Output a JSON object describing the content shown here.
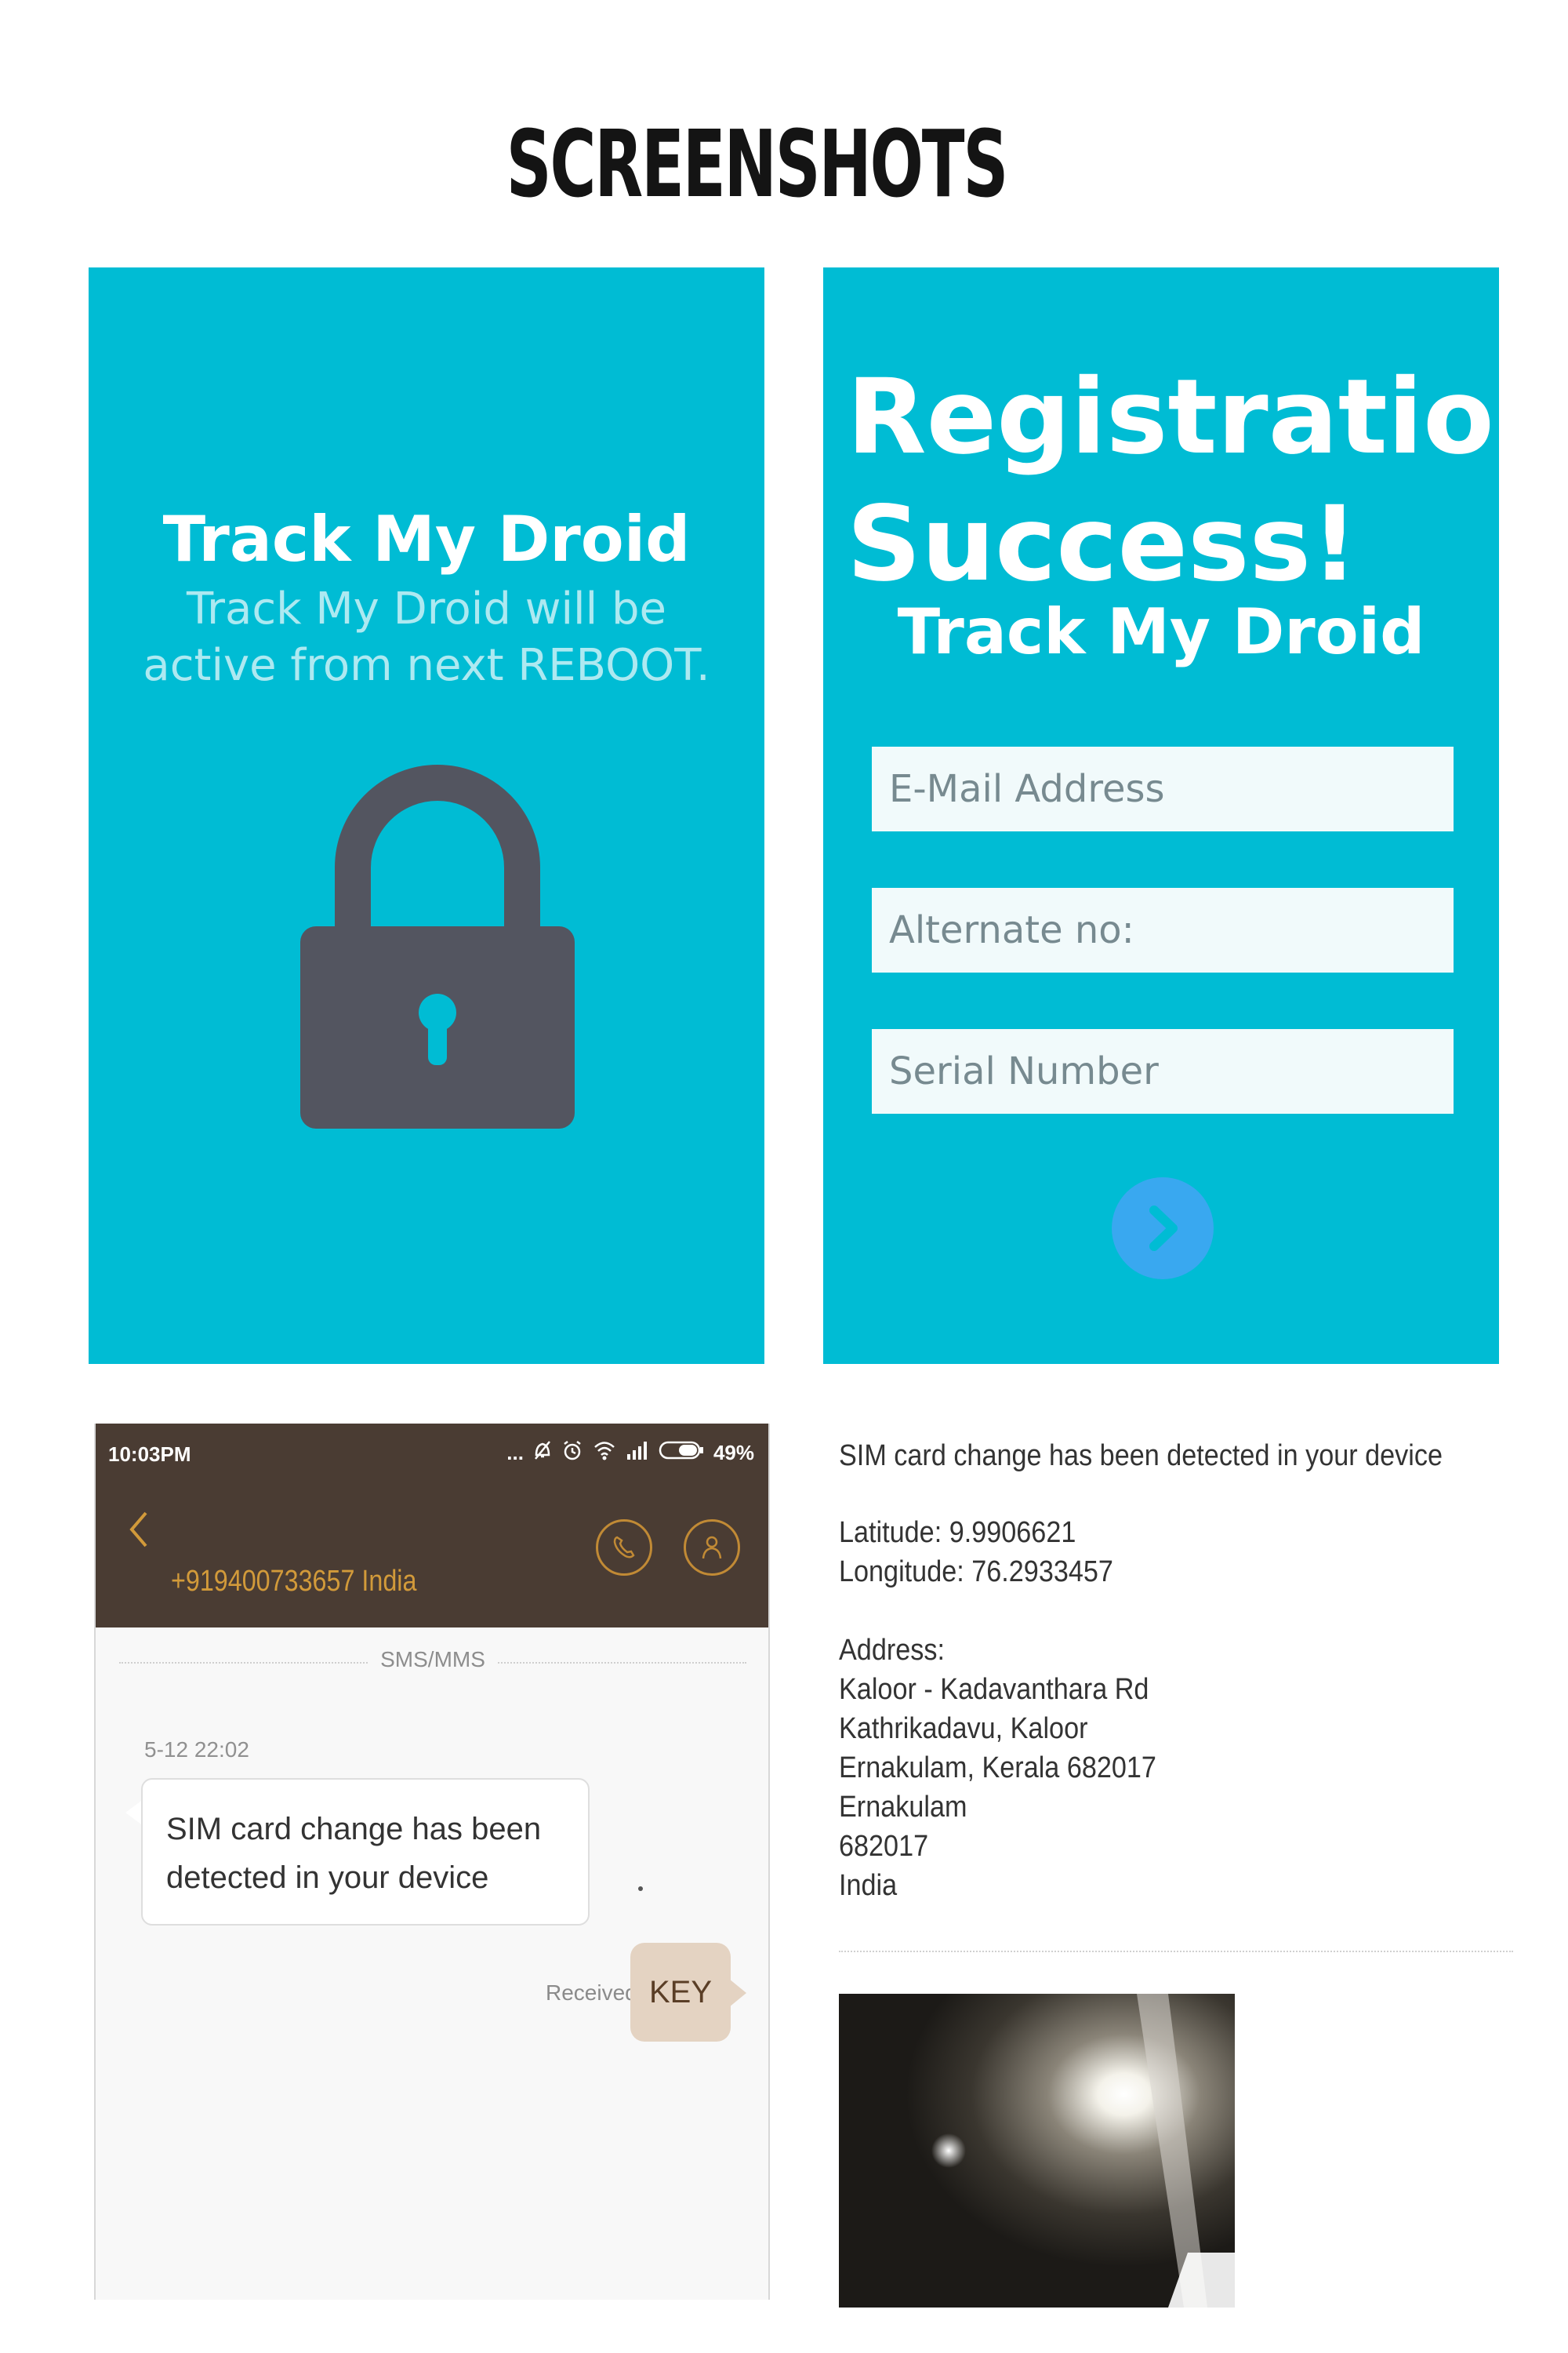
{
  "page": {
    "title": "SCREENSHOTS"
  },
  "active_screen": {
    "app_name": "Track My Droid",
    "message": "Track My Droid will be active from next REBOOT."
  },
  "registration": {
    "headline_line1": "Registration",
    "headline_line2": "Success!",
    "app_name": "Track My Droid",
    "email_placeholder": "E-Mail Address",
    "alternate_placeholder": "Alternate no:",
    "serial_placeholder": "Serial Number"
  },
  "sms": {
    "status_time": "10:03PM",
    "battery": "49%",
    "status_dots": "...",
    "contact_number": "+919400733657 India",
    "channel": "SMS/MMS",
    "timestamp": "5-12 22:02",
    "incoming_line1": "SIM card change has been",
    "incoming_line2": "detected in your device",
    "received_label": "Received",
    "outgoing_text": "KEY"
  },
  "email": {
    "heading": "SIM card change has been detected in your device",
    "latitude": "Latitude: 9.9906621",
    "longitude": "Longitude: 76.2933457",
    "address_label": "Address:",
    "address_lines": [
      "Kaloor - Kadavanthara Rd",
      "Kathrikadavu, Kaloor",
      "Ernakulam, Kerala 682017",
      "Ernakulam",
      "682017",
      "India"
    ]
  },
  "colors": {
    "cyan_panel": "#00bcd4",
    "lock": "#535560",
    "sms_header": "#4a3c33",
    "sms_accent": "#d29a3a",
    "next_button": "#39a8f0"
  }
}
